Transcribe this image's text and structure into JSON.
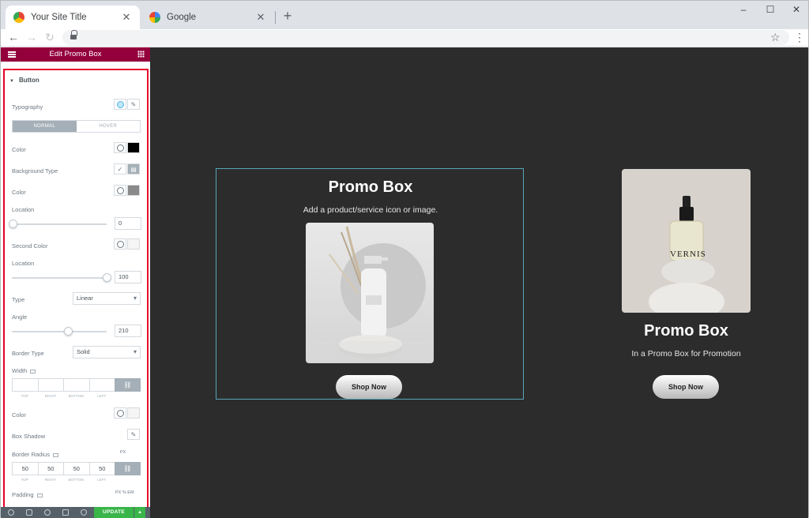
{
  "browser": {
    "tabs": [
      {
        "title": "Your Site Title",
        "active": true
      },
      {
        "title": "Google",
        "active": false
      }
    ],
    "new_tab": "+",
    "close_glyph": "✕",
    "window_controls": {
      "minimize": "–",
      "maximize": "☐",
      "close": "✕"
    },
    "nav": {
      "back": "←",
      "forward": "→",
      "reload": "↻"
    },
    "star": "☆",
    "menu": "⋮"
  },
  "editor": {
    "header_title": "Edit Promo Box",
    "section_title": "Button",
    "typography_label": "Typography",
    "state_tabs": {
      "normal": "NORMAL",
      "hover": "HOVER"
    },
    "color_label": "Color",
    "background_type_label": "Background Type",
    "bg_color_label": "Color",
    "location_label": "Location",
    "location_value": "0",
    "second_color_label": "Second Color",
    "location2_label": "Location",
    "location2_value": "100",
    "type_label": "Type",
    "type_value": "Linear",
    "angle_label": "Angle",
    "angle_value": "210",
    "border_type_label": "Border Type",
    "border_type_value": "Solid",
    "width_label": "Width",
    "dim_labels": {
      "top": "TOP",
      "right": "RIGHT",
      "bottom": "BOTTOM",
      "left": "LEFT"
    },
    "border_color_label": "Color",
    "box_shadow_label": "Box Shadow",
    "border_radius_label": "Border Radius",
    "radius_values": {
      "top": "50",
      "right": "50",
      "bottom": "50",
      "left": "50"
    },
    "radius_unit": "PX",
    "padding_label": "Padding",
    "padding_units": "PX  %  EM",
    "update_label": "UPDATE",
    "collapse_glyph": "‹"
  },
  "colors": {
    "header_bg": "#93003c",
    "button_text_color": "#000000",
    "bg_color_swatch": "#8a8a8a",
    "second_color_swatch": "#f5f5f5",
    "update_green": "#39b54a",
    "highlight_red": "#e4002b"
  },
  "canvas": {
    "promo1": {
      "title": "Promo Box",
      "subtitle": "Add a product/service icon or image.",
      "button": "Shop Now"
    },
    "promo2": {
      "title": "Promo Box",
      "subtitle": "In a Promo Box for Promotion",
      "button": "Shop Now",
      "bottle_label": "VERNIS"
    }
  },
  "slider_levels": {
    "location": 0,
    "location2": 1,
    "angle": 0.58
  }
}
